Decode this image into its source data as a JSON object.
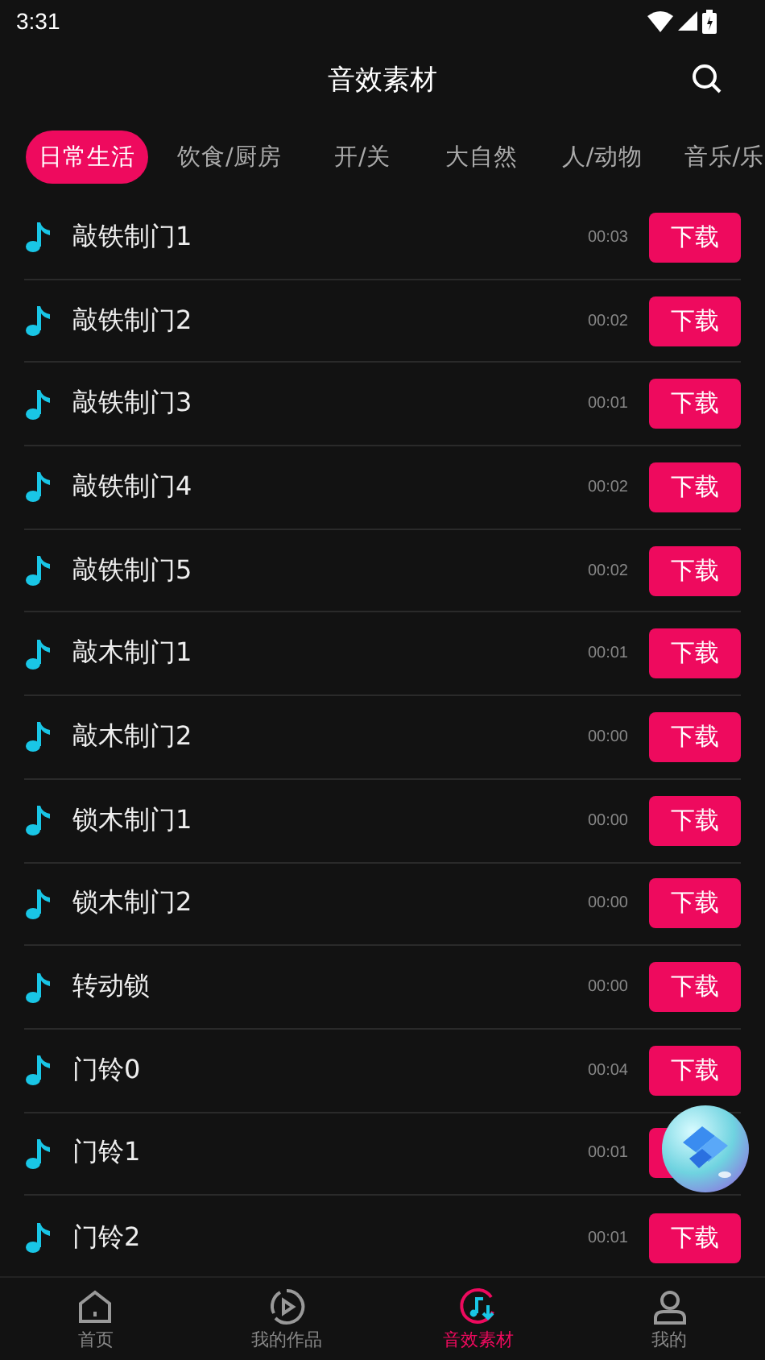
{
  "status_bar": {
    "time": "3:31"
  },
  "header": {
    "title": "音效素材"
  },
  "tabs": [
    {
      "label": "日常生活",
      "selected": true
    },
    {
      "label": "饮食/厨房",
      "selected": false
    },
    {
      "label": "开/关",
      "selected": false
    },
    {
      "label": "大自然",
      "selected": false
    },
    {
      "label": "人/动物",
      "selected": false
    },
    {
      "label": "音乐/乐",
      "selected": false
    }
  ],
  "sounds": [
    {
      "name": "敲铁制门1",
      "duration": "00:03",
      "button": "下载"
    },
    {
      "name": "敲铁制门2",
      "duration": "00:02",
      "button": "下载"
    },
    {
      "name": "敲铁制门3",
      "duration": "00:01",
      "button": "下载"
    },
    {
      "name": "敲铁制门4",
      "duration": "00:02",
      "button": "下载"
    },
    {
      "name": "敲铁制门5",
      "duration": "00:02",
      "button": "下载"
    },
    {
      "name": "敲木制门1",
      "duration": "00:01",
      "button": "下载"
    },
    {
      "name": "敲木制门2",
      "duration": "00:00",
      "button": "下载"
    },
    {
      "name": "锁木制门1",
      "duration": "00:00",
      "button": "下载"
    },
    {
      "name": "锁木制门2",
      "duration": "00:00",
      "button": "下载"
    },
    {
      "name": "转动锁",
      "duration": "00:00",
      "button": "下载"
    },
    {
      "name": "门铃0",
      "duration": "00:04",
      "button": "下载"
    },
    {
      "name": "门铃1",
      "duration": "00:01"
    },
    {
      "name": "门铃2",
      "duration": "00:01",
      "button": "下载"
    }
  ],
  "bottom_nav": [
    {
      "label": "首页",
      "kind": "home",
      "selected": false
    },
    {
      "label": "我的作品",
      "kind": "works",
      "selected": false
    },
    {
      "label": "音效素材",
      "kind": "sounds",
      "selected": true
    },
    {
      "label": "我的",
      "kind": "profile",
      "selected": false
    }
  ]
}
